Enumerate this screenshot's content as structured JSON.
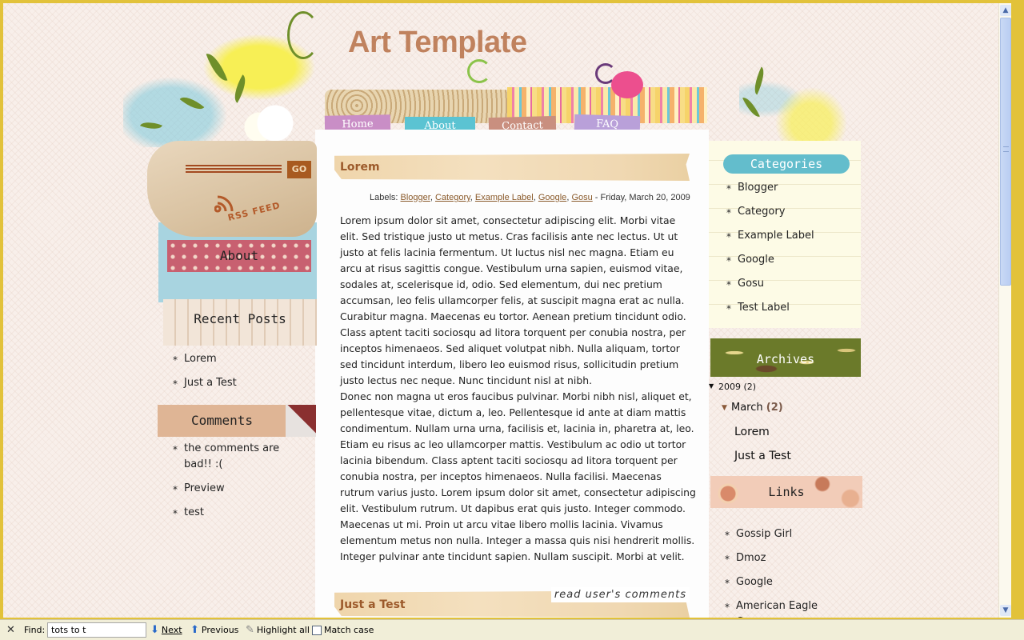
{
  "site": {
    "title": "Art Template"
  },
  "nav": {
    "tabs": [
      {
        "label": "Home",
        "color": "#c98ec6"
      },
      {
        "label": "About",
        "color": "#5bc3d2"
      },
      {
        "label": "Contact",
        "color": "#c98f7f"
      },
      {
        "label": "FAQ",
        "color": "#b9a0d9"
      }
    ]
  },
  "left_sidebar": {
    "rss": {
      "go_label": "GO",
      "feed_label": "RSS FEED"
    },
    "about_header": "About",
    "recent_header": "Recent Posts",
    "recent_posts": [
      "Lorem",
      "Just a Test"
    ],
    "comments_header": "Comments",
    "comments": [
      "the comments are bad!! :(",
      "Preview",
      "test"
    ]
  },
  "post": {
    "title": "Lorem",
    "labels_prefix": "Labels: ",
    "labels": [
      "Blogger",
      "Category",
      "Example Label",
      "Google",
      "Gosu"
    ],
    "date": " - Friday, March 20, 2009",
    "paragraphs": [
      "Lorem ipsum dolor sit amet, consectetur adipiscing elit. Morbi vitae elit. Sed tristique justo ut metus. Cras facilisis ante nec lectus. Ut ut justo at felis lacinia fermentum. Ut luctus nisl nec magna. Etiam eu arcu at risus sagittis congue. Vestibulum urna sapien, euismod vitae, sodales at, scelerisque id, odio. Sed elementum, dui nec pretium accumsan, leo felis ullamcorper felis, at suscipit magna erat ac nulla. Curabitur magna. Maecenas eu tortor. Aenean pretium tincidunt odio. Class aptent taciti sociosqu ad litora torquent per conubia nostra, per inceptos himenaeos. Sed aliquet volutpat nibh. Nulla aliquam, tortor sed tincidunt interdum, libero leo euismod risus, sollicitudin pretium justo lectus nec neque. Nunc tincidunt nisl at nibh.",
      "Donec non magna ut eros faucibus pulvinar. Morbi nibh nisl, aliquet et, pellentesque vitae, dictum a, leo. Pellentesque id ante at diam mattis condimentum. Nullam urna urna, facilisis et, lacinia in, pharetra at, leo. Etiam eu risus ac leo ullamcorper mattis. Vestibulum ac odio ut tortor lacinia bibendum. Class aptent taciti sociosqu ad litora torquent per conubia nostra, per inceptos himenaeos. Nulla facilisi. Maecenas rutrum varius justo. Lorem ipsum dolor sit amet, consectetur adipiscing elit. Vestibulum rutrum. Ut dapibus erat quis justo. Integer commodo. Maecenas ut mi. Proin ut arcu vitae libero mollis lacinia. Vivamus elementum metus non nulla. Integer a massa quis nisi hendrerit mollis. Integer pulvinar ante tincidunt sapien. Nullam suscipit. Morbi at velit."
    ],
    "read_comments": "read user's comments"
  },
  "next_post": {
    "title": "Just a Test"
  },
  "right_sidebar": {
    "categories_header": "Categories",
    "categories": [
      "Blogger",
      "Category",
      "Example Label",
      "Google",
      "Gosu",
      "Test Label"
    ],
    "archives_header": "Archives",
    "archive": {
      "year": "2009",
      "year_count": "(2)",
      "month": "March",
      "month_count": "(2)",
      "posts": [
        "Lorem",
        "Just a Test"
      ]
    },
    "links_header": "Links",
    "links": [
      "Gossip Girl",
      "Dmoz",
      "Google",
      "American Eagle Coupons"
    ]
  },
  "findbar": {
    "close_icon": "close-icon",
    "find_label": "Find:",
    "query": "tots to t",
    "next_label": "Next",
    "previous_label": "Previous",
    "highlight_label": "Highlight all",
    "match_case_label": "Match case",
    "match_case_checked": false
  },
  "colors": {
    "frame": "#e2c23a",
    "page_bg": "#f8efea",
    "title": "#c0825e",
    "post_title": "#9c5a2b",
    "label_link": "#8a5a2b"
  }
}
